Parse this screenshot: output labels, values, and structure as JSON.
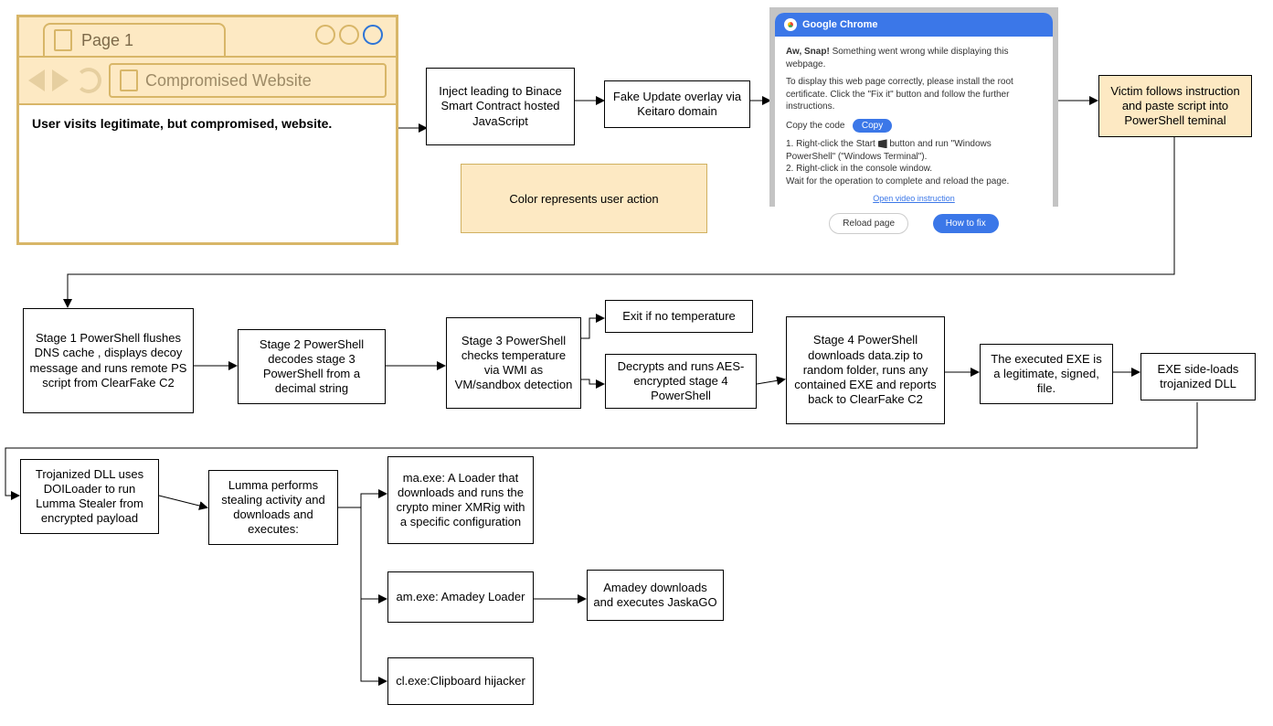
{
  "browser": {
    "tab_title": "Page 1",
    "url_display": "Compromised Website",
    "content_text": "User visits legitimate, but compromised, website."
  },
  "legend": {
    "text": "Color represents user action"
  },
  "boxes": {
    "inject": "Inject leading to Binace Smart Contract hosted JavaScript",
    "keitaro": "Fake Update overlay via Keitaro domain",
    "victim": "Victim follows instruction and paste script into PowerShell teminal",
    "stage1": "Stage 1 PowerShell flushes DNS cache , displays decoy message and runs remote PS script from ClearFake C2",
    "stage2": "Stage 2 PowerShell decodes stage 3 PowerShell from a decimal string",
    "stage3": "Stage 3 PowerShell checks temperature via WMI as VM/sandbox detection",
    "exit": "Exit if no temperature",
    "decrypt": "Decrypts and runs AES-encrypted stage 4 PowerShell",
    "stage4": "Stage 4 PowerShell downloads data.zip to random folder, runs any contained EXE and reports back to ClearFake C2",
    "exe_legit": "The executed EXE is a legitimate, signed, file.",
    "sideload": "EXE side-loads trojanized DLL",
    "trojan": "Trojanized DLL uses DOILoader to run Lumma Stealer from encrypted payload",
    "lumma": "Lumma performs stealing activity and downloads and executes:",
    "ma": "ma.exe: A Loader that downloads and runs the crypto miner XMRig with a specific configuration",
    "am": "am.exe: Amadey Loader",
    "cl": "cl.exe:Clipboard hijacker",
    "amadey": "Amadey downloads and executes JaskaGO"
  },
  "popup": {
    "title": "Google Chrome",
    "headline_bold": "Aw, Snap!",
    "headline_rest": " Something went wrong while displaying this webpage.",
    "p1": "To display this web page correctly, please install the root certificate. Click the \"Fix it\" button and follow the further instructions.",
    "copy_label": "Copy the code",
    "copy_btn": "Copy",
    "step1a": "1. Right-click the Start ",
    "step1b": " button and run \"Windows PowerShell\" (\"Windows Terminal\").",
    "step2": "2. Right-click in the console window.",
    "wait": "Wait for the operation to complete and reload the page.",
    "video_link": "Open video instruction",
    "reload": "Reload page",
    "howto": "How to fix"
  }
}
